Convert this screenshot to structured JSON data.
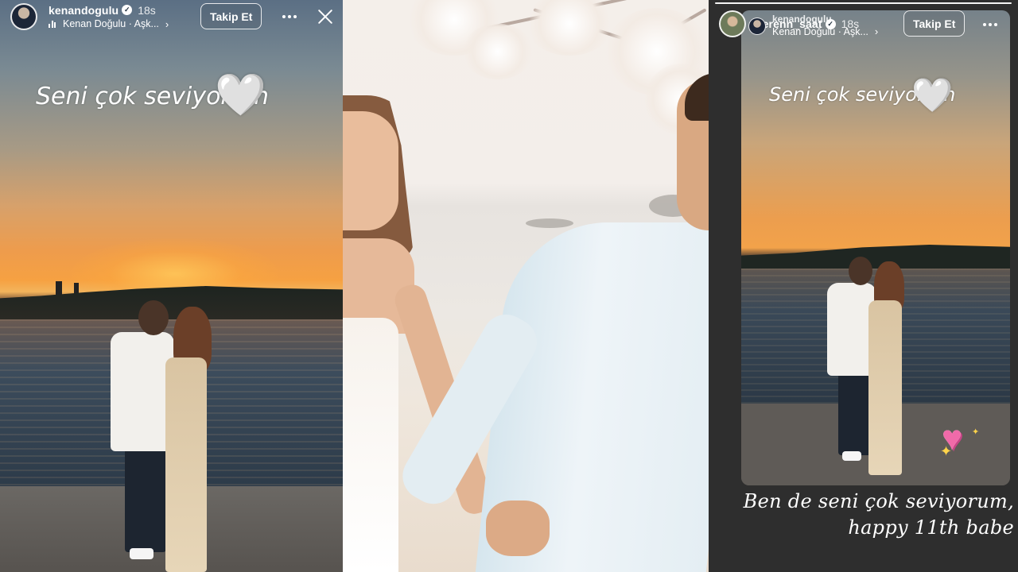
{
  "left_story": {
    "username": "kenandogulu",
    "verified_icon": "verified-badge-icon",
    "time": "18s",
    "music": "Kenan Doğulu · Aşk...",
    "follow_label": "Takip Et",
    "story_text": "Seni çok seviyorum",
    "text_emoji": "🤍"
  },
  "middle_photo": {},
  "right_story": {
    "username": "berenn_saat",
    "verified_icon": "verified-badge-icon",
    "time": "18s",
    "reshared_username": "kenandogulu",
    "music": "Kenan Doğulu · Aşk...",
    "follow_label": "Takip Et",
    "story_text": "Seni çok seviyorum",
    "text_emoji": "🤍",
    "caption_line1": "Ben de seni çok seviyorum,",
    "caption_line2": "happy 11th babe"
  },
  "colors": {
    "sunset_orange": "#f2a24a",
    "story_dark": "#2e2e2e",
    "heart_sticker": "#f06aa9"
  }
}
